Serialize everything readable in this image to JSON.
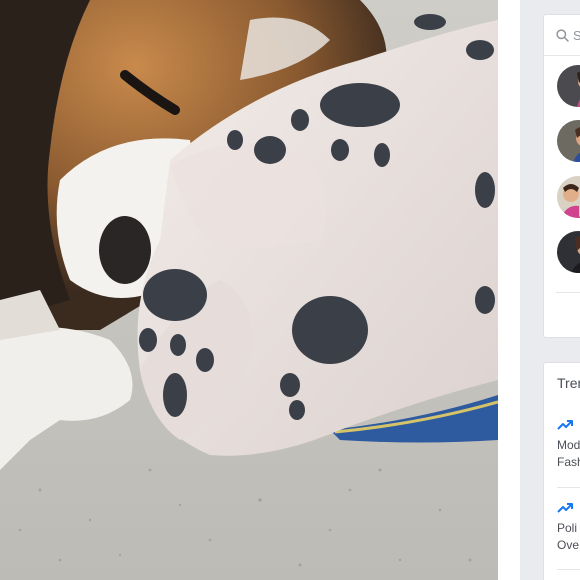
{
  "sidebar": {
    "search_placeholder": "S",
    "trending": {
      "title": "Tren",
      "items": [
        {
          "line1": "Mod",
          "line2": "Fash"
        },
        {
          "line1": "Poli",
          "line2": "Ove"
        }
      ]
    }
  },
  "colors": {
    "page_background": "#e9ebee",
    "panel_background": "#ffffff",
    "trending_arrow": "#1877f2"
  }
}
